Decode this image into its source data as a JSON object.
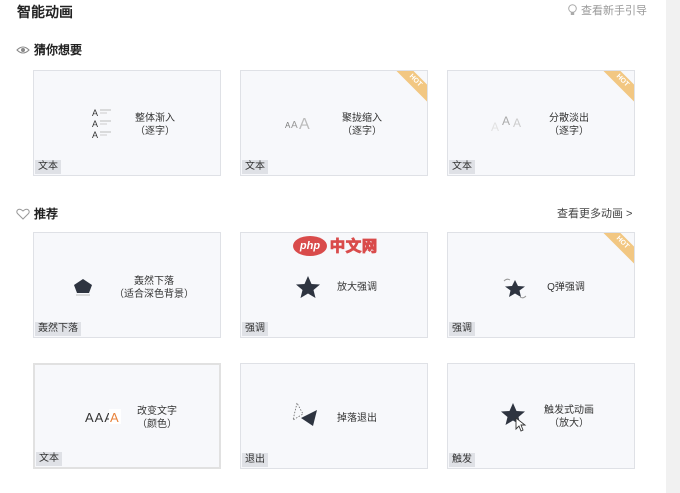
{
  "header": {
    "title": "智能动画",
    "guide_label": "查看新手引导"
  },
  "sections": {
    "guess": {
      "title": "猜你想要"
    },
    "recommend": {
      "title": "推荐",
      "more_label": "查看更多动画 >"
    }
  },
  "cards": [
    {
      "line1": "整体渐入",
      "line2": "（逐字）",
      "tag": "文本",
      "hot": false
    },
    {
      "line1": "聚拢缩入",
      "line2": "（逐字）",
      "tag": "文本",
      "hot": true
    },
    {
      "line1": "分散淡出",
      "line2": "（逐字）",
      "tag": "文本",
      "hot": true
    },
    {
      "line1": "轰然下落",
      "line2": "（适合深色背景）",
      "tag": "轰然下落",
      "hot": false
    },
    {
      "line1": "放大强调",
      "line2": "",
      "tag": "强调",
      "hot": false
    },
    {
      "line1": "Q弹强调",
      "line2": "",
      "tag": "强调",
      "hot": true
    },
    {
      "line1": "改变文字",
      "line2": "（颜色）",
      "tag": "文本",
      "hot": false
    },
    {
      "line1": "掉落退出",
      "line2": "",
      "tag": "退出",
      "hot": false
    },
    {
      "line1": "触发式动画",
      "line2": "（放大）",
      "tag": "触发",
      "hot": false
    }
  ],
  "hot_label": "HOT",
  "icon_text": {
    "a": "A",
    "aaa": "AAA"
  },
  "watermark": {
    "logo": "php",
    "text": "中文网"
  },
  "colors": {
    "accent_orange": "#e8823a",
    "hot_badge": "#f2c782",
    "icon_dark": "#2e3440"
  }
}
